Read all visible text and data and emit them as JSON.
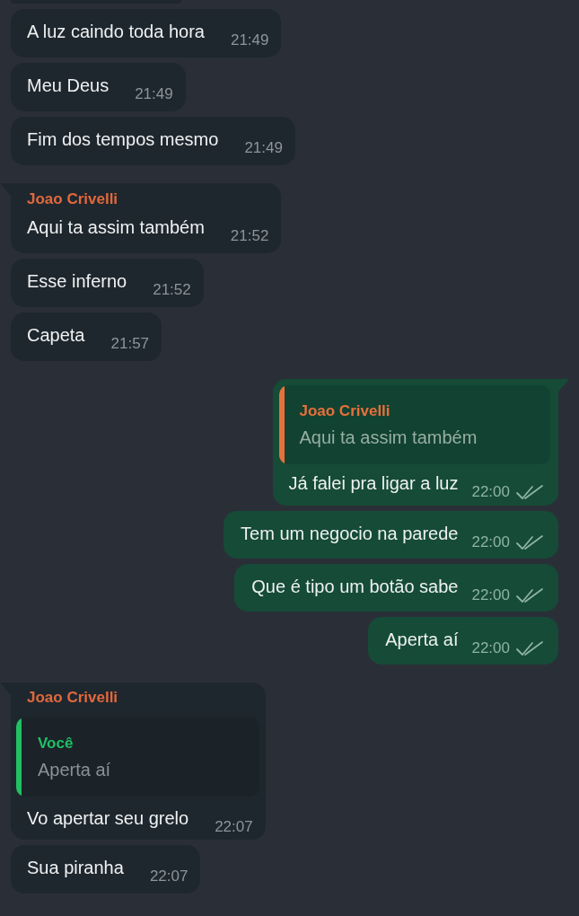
{
  "messages": [
    {
      "outgoing": false,
      "kind": "clipped",
      "tail": false
    },
    {
      "outgoing": false,
      "kind": "text",
      "tail": false,
      "text": "A luz caindo toda hora",
      "time": "21:49"
    },
    {
      "outgoing": false,
      "kind": "text",
      "tail": false,
      "text": "Meu Deus",
      "time": "21:49"
    },
    {
      "outgoing": false,
      "kind": "text",
      "tail": false,
      "text": "Fim dos tempos mesmo",
      "time": "21:49"
    },
    {
      "outgoing": false,
      "kind": "text",
      "tail": true,
      "sender": {
        "name": "Joao Crivelli",
        "color": "#e2683c"
      },
      "text": "Aqui ta assim também",
      "time": "21:52"
    },
    {
      "outgoing": false,
      "kind": "text",
      "tail": false,
      "text": "Esse inferno",
      "time": "21:52"
    },
    {
      "outgoing": false,
      "kind": "text",
      "tail": false,
      "text": "Capeta",
      "time": "21:57"
    },
    {
      "outgoing": true,
      "kind": "text",
      "tail": true,
      "quote": {
        "sender": "Joao Crivelli",
        "color": "#e8703a",
        "text": "Aqui ta assim também"
      },
      "text": "Já falei pra ligar a luz",
      "time": "22:00",
      "read": false
    },
    {
      "outgoing": true,
      "kind": "text",
      "tail": false,
      "text": "Tem um negocio na parede",
      "time": "22:00",
      "read": false
    },
    {
      "outgoing": true,
      "kind": "text",
      "tail": false,
      "text": "Que é tipo um botão sabe",
      "time": "22:00",
      "read": false
    },
    {
      "outgoing": true,
      "kind": "text",
      "tail": false,
      "text": "Aperta aí",
      "time": "22:00",
      "read": false
    },
    {
      "outgoing": false,
      "kind": "text",
      "tail": true,
      "sender": {
        "name": "Joao Crivelli",
        "color": "#e2683c"
      },
      "quote": {
        "sender": "Você",
        "color": "#21c063",
        "text": "Aperta aí"
      },
      "text": "Vo apertar seu grelo",
      "time": "22:07"
    },
    {
      "outgoing": false,
      "kind": "text",
      "tail": false,
      "text": "Sua piranha",
      "time": "22:07"
    }
  ]
}
